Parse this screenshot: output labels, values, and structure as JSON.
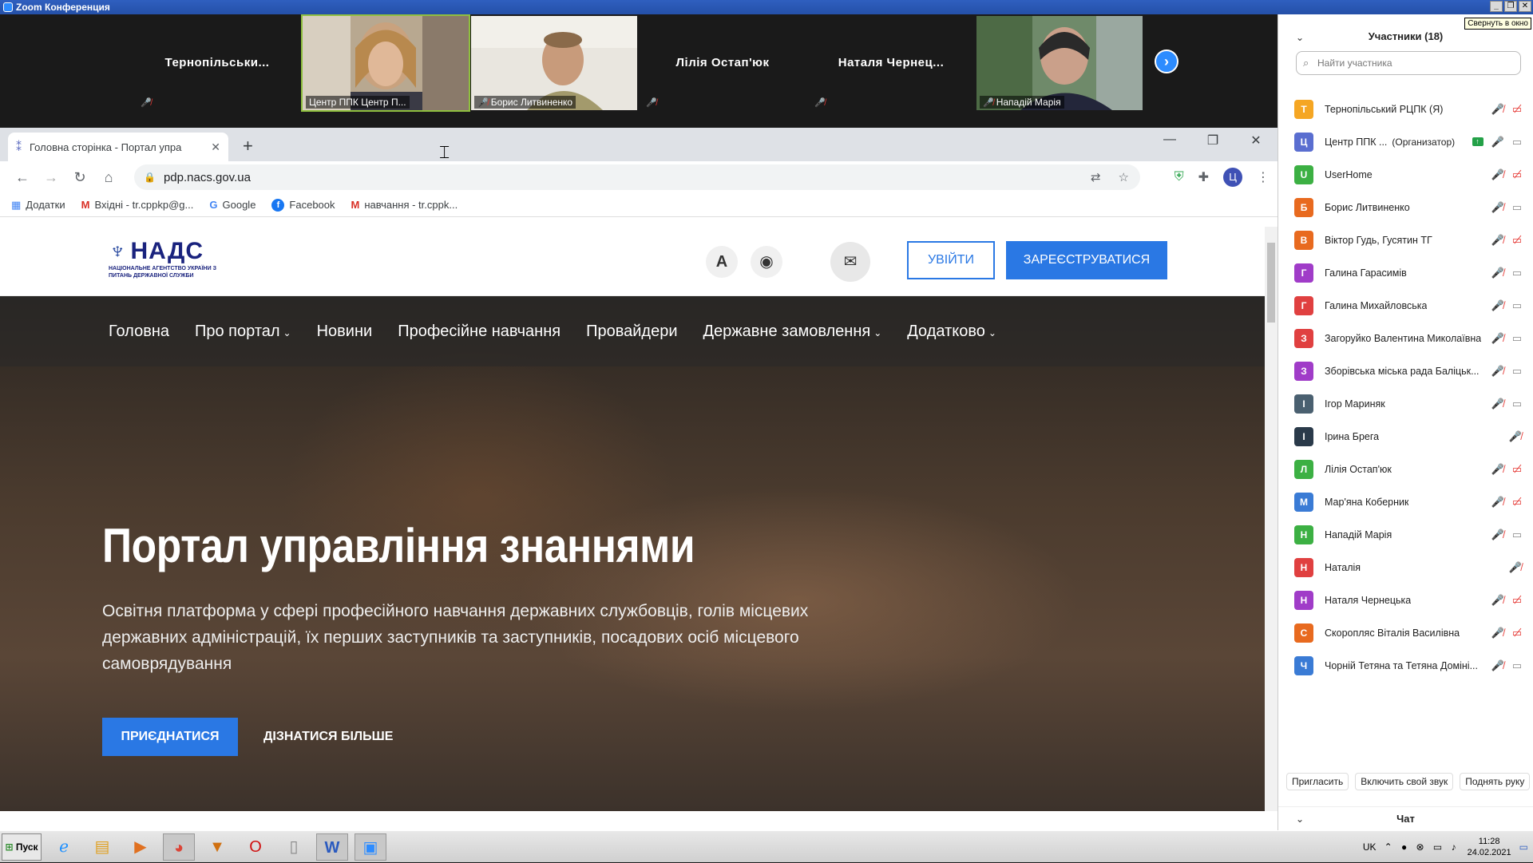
{
  "zoom": {
    "title": "Zoom Конференция",
    "window_buttons": [
      "_",
      "❐",
      "✕"
    ]
  },
  "video_strip": {
    "tiles": [
      {
        "name": "Тернопільськи...",
        "label": "",
        "muted": true,
        "video": false
      },
      {
        "name": "",
        "label": "Центр ППК Центр П...",
        "muted": false,
        "video": true,
        "active": true
      },
      {
        "name": "",
        "label": "Борис Литвиненко",
        "muted": true,
        "video": true
      },
      {
        "name": "Лілія Остап'юк",
        "label": "",
        "muted": true,
        "video": false
      },
      {
        "name": "Наталя  Чернец...",
        "label": "",
        "muted": true,
        "video": false
      },
      {
        "name": "",
        "label": "Нападій Марія",
        "muted": true,
        "video": true
      }
    ],
    "next_icon": "chevron-right-icon"
  },
  "browser": {
    "tab_title": "Головна сторінка - Портал упра",
    "url": "pdp.nacs.gov.ua",
    "bookmarks": [
      {
        "label": "Додатки",
        "icon": "apps-icon"
      },
      {
        "label": "Вхідні - tr.cppkp@g...",
        "icon": "gmail-icon"
      },
      {
        "label": "Google",
        "icon": "google-icon"
      },
      {
        "label": "Facebook",
        "icon": "facebook-icon"
      },
      {
        "label": "навчання - tr.cppk...",
        "icon": "gmail-icon"
      }
    ],
    "profile_initial": "Ц"
  },
  "site": {
    "logo_main": "НАДС",
    "logo_sub": "НАЦІОНАЛЬНЕ АГЕНТСТВО УКРАЇНИ З ПИТАНЬ ДЕРЖАВНОЇ СЛУЖБИ",
    "login": "УВІЙТИ",
    "register": "ЗАРЕЄСТРУВАТИСЯ",
    "nav": [
      {
        "label": "Головна",
        "dropdown": false
      },
      {
        "label": "Про портал",
        "dropdown": true
      },
      {
        "label": "Новини",
        "dropdown": false
      },
      {
        "label": "Професійне навчання",
        "dropdown": false
      },
      {
        "label": "Провайдери",
        "dropdown": false
      },
      {
        "label": "Державне замовлення",
        "dropdown": true
      },
      {
        "label": "Додатково",
        "dropdown": true
      }
    ],
    "hero_title": "Портал управління знаннями",
    "hero_subtitle": "Освітня платформа у сфері професійного навчання державних службовців, голів місцевих державних адміністрацій, їх перших заступників та заступників, посадових осіб місцевого самоврядування",
    "join": "ПРИЄДНАТИСЯ",
    "more": "ДІЗНАТИСЯ БІЛЬШЕ"
  },
  "participants": {
    "tooltip": "Свернуть в окно",
    "title": "Участники (18)",
    "search_placeholder": "Найти участника",
    "list": [
      {
        "initial": "Т",
        "color": "#f5a623",
        "name": "Тернопільський РЦПК (Я)",
        "role": "",
        "muted": true,
        "cam": "off"
      },
      {
        "initial": "Ц",
        "color": "#5a6ed0",
        "name": "Центр ППК ...",
        "role": "(Организатор)",
        "muted": false,
        "cam": "on",
        "share": true
      },
      {
        "initial": "U",
        "color": "#3cb043",
        "name": "UserHome",
        "role": "",
        "muted": true,
        "cam": "off"
      },
      {
        "initial": "Б",
        "color": "#e86a1f",
        "name": "Борис Литвиненко",
        "role": "",
        "muted": true,
        "cam": "on"
      },
      {
        "initial": "В",
        "color": "#e86a1f",
        "name": "Віктор Гудь, Гусятин ТГ",
        "role": "",
        "muted": true,
        "cam": "off"
      },
      {
        "initial": "Г",
        "color": "#a03cc8",
        "name": "Галина Гарасимів",
        "role": "",
        "muted": true,
        "cam": "on"
      },
      {
        "initial": "Г",
        "color": "#e04040",
        "name": "Галина Михайловська",
        "role": "",
        "muted": true,
        "cam": "on"
      },
      {
        "initial": "З",
        "color": "#e04040",
        "name": "Загоруйко Валентина Миколаївна",
        "role": "",
        "muted": true,
        "cam": "on"
      },
      {
        "initial": "З",
        "color": "#a03cc8",
        "name": "Зборівська міська рада Баліцьк...",
        "role": "",
        "muted": true,
        "cam": "on"
      },
      {
        "initial": "І",
        "color": "#4a6070",
        "name": "Ігор Мариняк",
        "role": "",
        "muted": true,
        "cam": "on"
      },
      {
        "initial": "І",
        "color": "#2a3a4a",
        "name": "Ірина Брега",
        "role": "",
        "muted": true,
        "cam": "none"
      },
      {
        "initial": "Л",
        "color": "#3cb043",
        "name": "Лілія Остап'юк",
        "role": "",
        "muted": true,
        "cam": "off"
      },
      {
        "initial": "М",
        "color": "#3a7bd5",
        "name": "Мар'яна Коберник",
        "role": "",
        "muted": true,
        "cam": "off"
      },
      {
        "initial": "Н",
        "color": "#3cb043",
        "name": "Нападій Марія",
        "role": "",
        "muted": true,
        "cam": "on"
      },
      {
        "initial": "Н",
        "color": "#e04040",
        "name": "Наталія",
        "role": "",
        "muted": true,
        "cam": "none"
      },
      {
        "initial": "Н",
        "color": "#a03cc8",
        "name": "Наталя Чернецька",
        "role": "",
        "muted": true,
        "cam": "off"
      },
      {
        "initial": "С",
        "color": "#e86a1f",
        "name": "Скоропляс Віталія Василівна",
        "role": "",
        "muted": true,
        "cam": "off"
      },
      {
        "initial": "Ч",
        "color": "#3a7bd5",
        "name": "Чорній Тетяна та Тетяна Доміні...",
        "role": "",
        "muted": true,
        "cam": "on"
      }
    ],
    "buttons": {
      "invite": "Пригласить",
      "unmute": "Включить свой звук",
      "raise": "Поднять руку"
    },
    "chat": "Чат"
  },
  "taskbar": {
    "start": "Пуск",
    "apps": [
      "ie-icon",
      "explorer-icon",
      "media-player-icon",
      "chrome-icon",
      "app-icon",
      "opera-icon",
      "file-icon",
      "word-icon",
      "zoom-icon"
    ],
    "lang": "UK",
    "time": "11:28",
    "date": "24.02.2021"
  }
}
